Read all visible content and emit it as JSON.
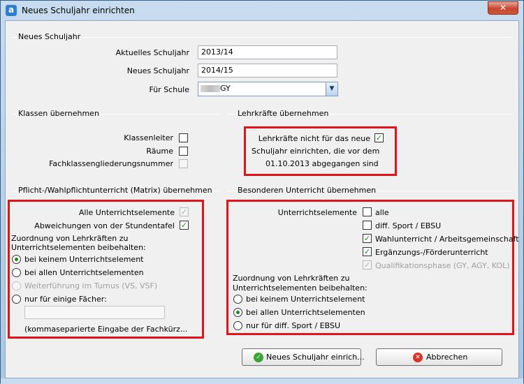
{
  "window": {
    "title": "Neues Schuljahr einrichten",
    "app_icon_letter": "a",
    "close_symbol": "✕"
  },
  "neues_schuljahr": {
    "group_title": "Neues Schuljahr",
    "aktuelles_label": "Aktuelles Schuljahr",
    "aktuelles_value": "2013/14",
    "neues_label": "Neues Schuljahr",
    "neues_value": "2014/15",
    "schule_label": "Für Schule",
    "schule_value": "GY",
    "schule_arrow": "▼"
  },
  "klassen": {
    "group_title": "Klassen übernehmen",
    "klassenleiter_label": "Klassenleiter",
    "raeume_label": "Räume",
    "fachklassen_label": "Fachklassengliederungsnummer"
  },
  "lehrkraefte": {
    "group_title": "Lehrkräfte übernehmen",
    "line1": "Lehrkräfte nicht für das neue",
    "line2": "Schuljahr einrichten, die vor dem",
    "line3": "01.10.2013 abgegangen sind"
  },
  "pflicht": {
    "group_title": "Pflicht-/Wahlpflichtunterricht (Matrix) übernehmen",
    "alle_label": "Alle Unterrichtselemente",
    "abweichungen_label": "Abweichungen von der Stundentafel",
    "zuordnung_line1": "Zuordnung von Lehrkräften zu",
    "zuordnung_line2": "Unterrichtselementen beibehalten:",
    "radio_keinem": "bei keinem Unterrichtselement",
    "radio_allen": "bei allen Unterrichtselementen",
    "radio_turnus": "Weiterführung im Turnus (VS, VSF)",
    "radio_einige": "nur für einige Fächer:",
    "faecher_value": "",
    "hint": "(kommaseparierte Eingabe der Fachkürz..."
  },
  "besonderer": {
    "group_title": "Besonderen Unterricht übernehmen",
    "ue_label": "Unterrichtselemente",
    "opt_alle": "alle",
    "opt_sport": "diff. Sport / EBSU",
    "opt_wahl": "Wahlunterricht / Arbeitsgemeinschaft",
    "opt_ergaenzung": "Ergänzungs-/Förderunterricht",
    "opt_quali": "Qualifikationsphase (GY, AGY, KOL)",
    "zuordnung_line1": "Zuordnung von Lehrkräften zu",
    "zuordnung_line2": "Unterrichtselementen beibehalten:",
    "radio_keinem": "bei keinem Unterrichtselement",
    "radio_allen": "bei allen Unterrichtselementen",
    "radio_sport": "nur für diff. Sport / EBSU"
  },
  "buttons": {
    "ok_label": "Neues Schuljahr einrich...",
    "ok_icon": "✓",
    "cancel_label": "Abbrechen",
    "cancel_icon": "✕"
  },
  "check_mark": "✓",
  "colors": {
    "highlight_red": "#e0141b",
    "check_green": "#1a8a1a",
    "title_blue": "#c9dcef"
  }
}
